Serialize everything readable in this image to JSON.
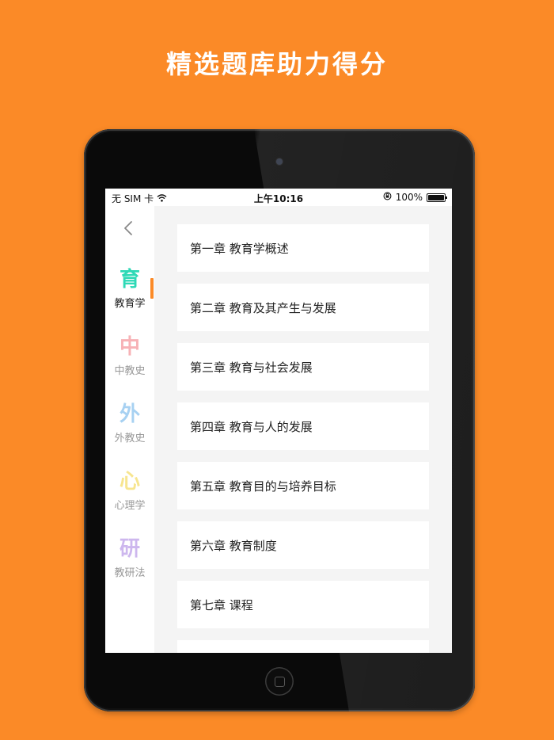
{
  "headline": "精选题库助力得分",
  "status_bar": {
    "carrier": "无 SIM 卡",
    "time": "上午10:16",
    "battery_percent": "100%",
    "battery_level": 1.0
  },
  "sidebar": {
    "categories": [
      {
        "glyph": "育",
        "label": "教育学",
        "color": "#2ed9b6",
        "active": true
      },
      {
        "glyph": "中",
        "label": "中教史",
        "color": "#f7b2b6",
        "active": false
      },
      {
        "glyph": "外",
        "label": "外教史",
        "color": "#a7d1f2",
        "active": false
      },
      {
        "glyph": "心",
        "label": "心理学",
        "color": "#f7e58f",
        "active": false
      },
      {
        "glyph": "研",
        "label": "教研法",
        "color": "#cdb7ee",
        "active": false
      }
    ]
  },
  "chapters": [
    "第一章 教育学概述",
    "第二章 教育及其产生与发展",
    "第三章 教育与社会发展",
    "第四章 教育与人的发展",
    "第五章 教育目的与培养目标",
    "第六章 教育制度",
    "第七章 课程",
    ""
  ],
  "colors": {
    "background": "#fb8a27",
    "accent": "#fb8a27"
  },
  "icons": {
    "back": "chevron-left-icon",
    "wifi": "wifi-icon",
    "rotation_lock": "rotation-lock-icon",
    "battery": "battery-icon"
  }
}
